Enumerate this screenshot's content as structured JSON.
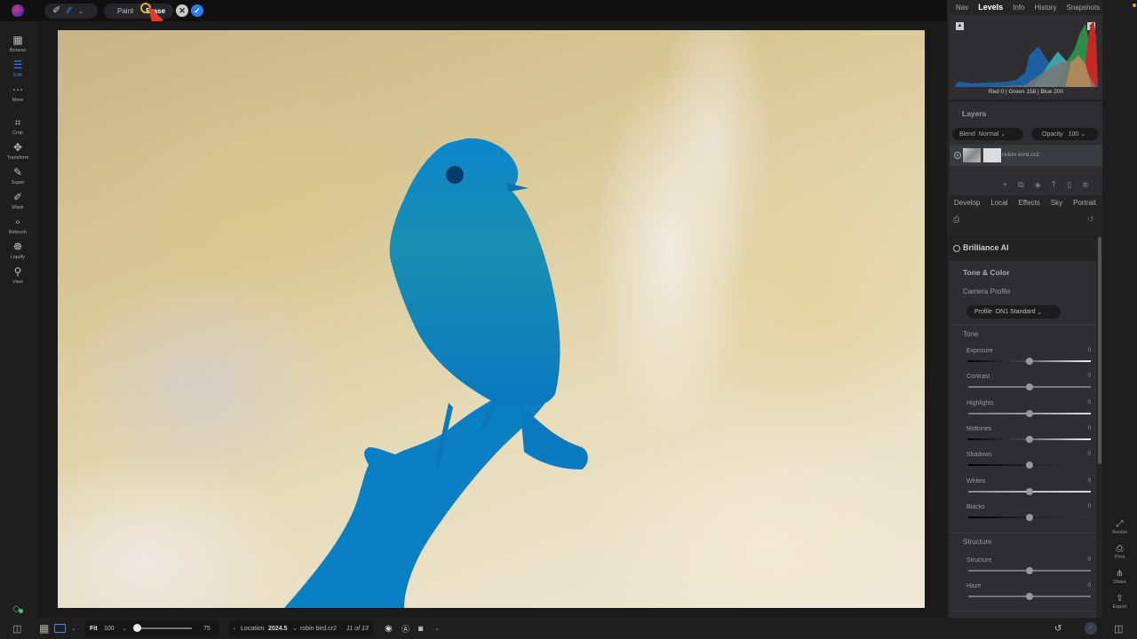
{
  "toolbar": {
    "brush_tool_icon": "paint-brush-icon",
    "ai_tool_icon": "ai-brush-icon",
    "mode_paint": "Paint",
    "mode_erase": "Erase",
    "cancel_glyph": "✕",
    "apply_glyph": "✓"
  },
  "left_sidebar": {
    "items": [
      {
        "label": "Browse",
        "icon": "▦"
      },
      {
        "label": "Edit",
        "icon": "☰"
      },
      {
        "label": "More",
        "icon": "⋯"
      },
      {
        "label": "Crop",
        "icon": "⌗"
      },
      {
        "label": "Transform",
        "icon": "✥"
      },
      {
        "label": "Super",
        "icon": "✎"
      },
      {
        "label": "Mask",
        "icon": "✐"
      },
      {
        "label": "Retouch",
        "icon": "∘"
      },
      {
        "label": "Liquify",
        "icon": "☸"
      },
      {
        "label": "View",
        "icon": "⚲"
      }
    ],
    "active": "Edit"
  },
  "right_panel": {
    "tabs": [
      "Nav",
      "Levels",
      "Info",
      "History",
      "Snapshots"
    ],
    "active_tab": "Levels",
    "histogram": {
      "readout": "Red   0   | Green 158 | Blue 200"
    },
    "layers": {
      "title": "Layers",
      "blend_label": "Blend",
      "blend_value": "Normal",
      "opacity_label": "Opacity",
      "opacity_value": "100",
      "layer_name": "robin bird.cr2"
    },
    "module_tabs": [
      "Develop",
      "Local",
      "Effects",
      "Sky",
      "Portrait"
    ],
    "brilliance": "Brilliance AI",
    "tone_color": {
      "title": "Tone & Color",
      "camera_profile": "Camera Profile",
      "profile_label": "Profile",
      "profile_value": "ON1 Standard",
      "tone_title": "Tone",
      "sliders": [
        {
          "label": "Exposure",
          "value": "0",
          "position": 0.5
        },
        {
          "label": "Contrast",
          "value": "0",
          "position": 0.5
        },
        {
          "label": "Highlights",
          "value": "0",
          "position": 0.5
        },
        {
          "label": "Midtones",
          "value": "0",
          "position": 0.5
        },
        {
          "label": "Shadows",
          "value": "0",
          "position": 0.5
        },
        {
          "label": "Whites",
          "value": "0",
          "position": 0.5
        },
        {
          "label": "Blacks",
          "value": "0",
          "position": 0.5
        }
      ],
      "structure_title": "Structure",
      "structure_sliders": [
        {
          "label": "Structure",
          "value": "0",
          "position": 0.5
        },
        {
          "label": "Haze",
          "value": "0",
          "position": 0.5
        }
      ]
    }
  },
  "far_right": {
    "items": [
      {
        "label": "Resize",
        "icon": "⤢"
      },
      {
        "label": "Print",
        "icon": "⎙"
      },
      {
        "label": "Share",
        "icon": "⋔"
      },
      {
        "label": "Export",
        "icon": "⇪"
      }
    ]
  },
  "bottom_bar": {
    "fit_label": "Fit",
    "zoom_value": "100",
    "slider_value": "75",
    "slider_position": 0.0,
    "location_label": "Location",
    "folder": "2024.5",
    "filename": "robin bird.cr2",
    "counter": "11 of 13"
  },
  "colors": {
    "accent": "#2d7cf5",
    "mask_overlay": "#0a82c8",
    "notification": "#e2a23b"
  }
}
